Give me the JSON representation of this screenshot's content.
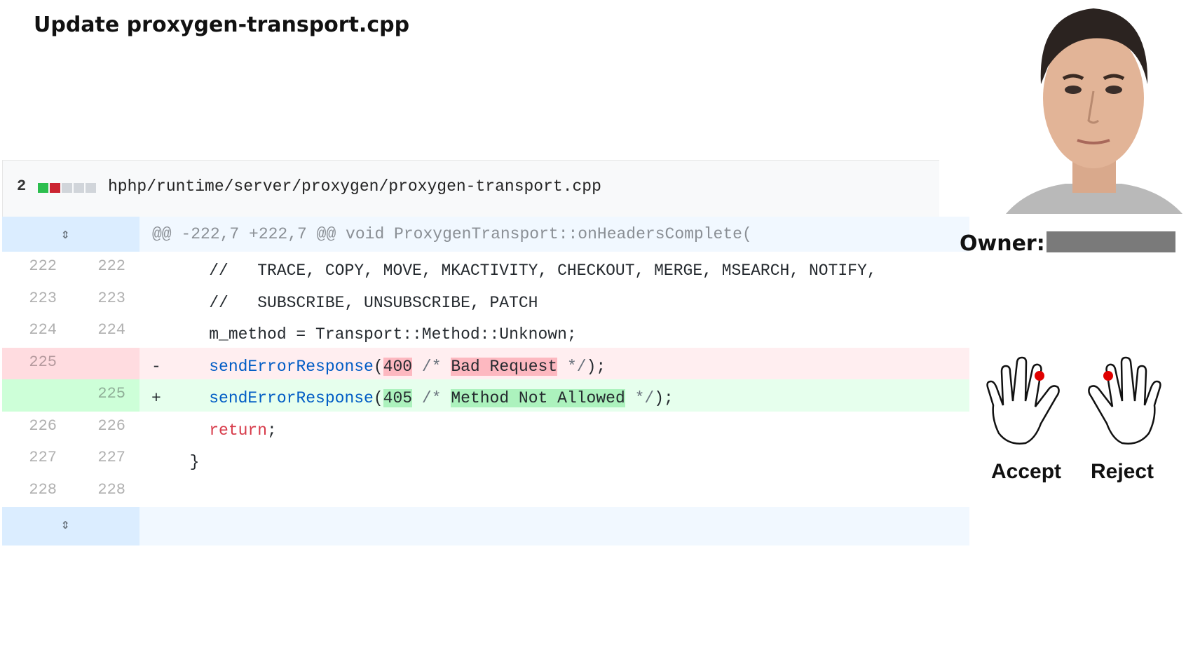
{
  "title": "Update proxygen-transport.cpp",
  "file": {
    "change_count": "2",
    "blocks": [
      "#2cbe4e",
      "#cb2431",
      "#d1d5da",
      "#d1d5da",
      "#d1d5da"
    ],
    "path": "hphp/runtime/server/proxygen/proxygen-transport.cpp"
  },
  "hunk_header": "@@ -222,7 +222,7 @@ void ProxygenTransport::onHeadersComplete(",
  "lines": [
    {
      "old": "222",
      "new": "222",
      "text": "    //   TRACE, COPY, MOVE, MKACTIVITY, CHECKOUT, MERGE, MSEARCH, NOTIFY,"
    },
    {
      "old": "223",
      "new": "223",
      "text": "    //   SUBSCRIBE, UNSUBSCRIBE, PATCH"
    },
    {
      "old": "224",
      "new": "224",
      "text": "    m_method = Transport::Method::Unknown;"
    }
  ],
  "deleted": {
    "old": "225",
    "sign": "-",
    "fn": "sendErrorResponse",
    "open": "(",
    "code_num": "400",
    "c_open": " /* ",
    "msg": "Bad Request",
    "c_close": " */",
    "end": ");"
  },
  "added": {
    "new": "225",
    "sign": "+",
    "fn": "sendErrorResponse",
    "open": "(",
    "code_num": "405",
    "c_open": " /* ",
    "msg": "Method Not Allowed",
    "c_close": " */",
    "end": ");"
  },
  "after": [
    {
      "old": "226",
      "new": "226",
      "kw": "return",
      "rest": ";"
    },
    {
      "old": "227",
      "new": "227",
      "text": "  }"
    },
    {
      "old": "228",
      "new": "228",
      "text": ""
    }
  ],
  "owner": {
    "label": "Owner:"
  },
  "hands": {
    "accept": "Accept",
    "reject": "Reject"
  }
}
